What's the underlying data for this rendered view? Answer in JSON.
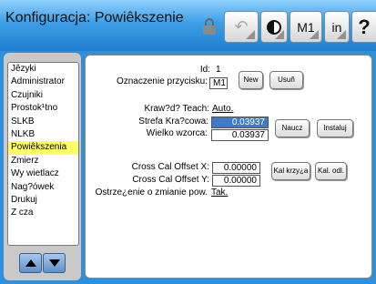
{
  "header": {
    "title": "Konfiguracja: Powiêkszenie",
    "buttons": {
      "undo": "↶",
      "m1": "M1",
      "units": "in",
      "help": "?"
    }
  },
  "sidebar": {
    "items": [
      {
        "label": "Jêzyki"
      },
      {
        "label": "Administrator"
      },
      {
        "label": "Czujniki"
      },
      {
        "label": "Prostok¹tno"
      },
      {
        "label": "SLKB"
      },
      {
        "label": "NLKB"
      },
      {
        "label": "Powiêkszenia"
      },
      {
        "label": "Zmierz"
      },
      {
        "label": "Wy wietlacz"
      },
      {
        "label": "Nag?ówek"
      },
      {
        "label": "Drukuj"
      },
      {
        "label": "Z cza"
      }
    ],
    "selected": "Powiêkszenia"
  },
  "panel": {
    "id_label": "Id:",
    "id_value": "1",
    "button_label_label": "Oznaczenie przycisku:",
    "button_label_value": "M1",
    "new_button": "New",
    "delete_button": "Usuñ",
    "edge_teach_label": "Kraw?d? Teach:",
    "edge_teach_value": "Auto.",
    "edge_zone_label": "Strefa Kra?cowa:",
    "edge_zone_value": "0.03937",
    "template_size_label": "Wielko  wzorca:",
    "template_size_value": "0.03937",
    "teach_button": "Naucz",
    "install_button": "Instaluj",
    "offset_x_label": "Cross Cal Offset X:",
    "offset_x_value": "0.00000",
    "offset_y_label": "Cross Cal Offset Y:",
    "offset_y_value": "0.00000",
    "calibrate_button": "Kal krzy¿a",
    "calibrate_read_button": "Kal. odl.",
    "change_warning_label": "Ostrze¿enie o zmianie pow.",
    "change_warning_value": "Tak."
  },
  "colors": {
    "header_blue": "#3d9ee6",
    "selection_yellow": "#ffff66",
    "active_field_blue": "#3f79c9"
  }
}
